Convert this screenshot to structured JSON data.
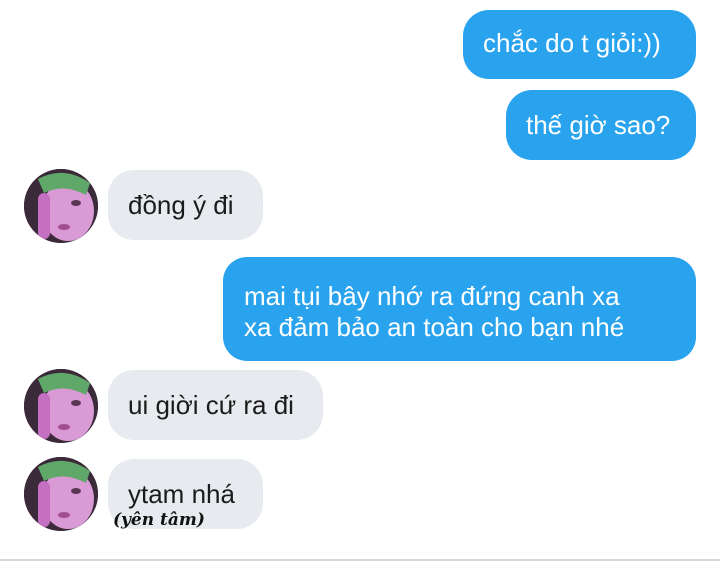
{
  "conversation": {
    "messages": [
      {
        "sender": "me",
        "text": "chắc do t giỏi:))"
      },
      {
        "sender": "me",
        "text": "thế giờ sao?"
      },
      {
        "sender": "other",
        "text": "đồng ý đi"
      },
      {
        "sender": "me",
        "lines": [
          "mai tụi bây nhớ ra đứng canh xa",
          "xa đảm bảo an toàn cho bạn nhé"
        ]
      },
      {
        "sender": "other",
        "text": "ui giời cứ ra đi"
      },
      {
        "sender": "other",
        "text": "ytam nhá"
      }
    ],
    "annotation": "(yên tâm)"
  },
  "colors": {
    "outgoing_bubble": "#2aa3ef",
    "incoming_bubble": "#e7eaee",
    "outgoing_text": "#ffffff",
    "incoming_text": "#1b1b1b"
  },
  "icons": {
    "avatar": "contact-avatar-image"
  }
}
